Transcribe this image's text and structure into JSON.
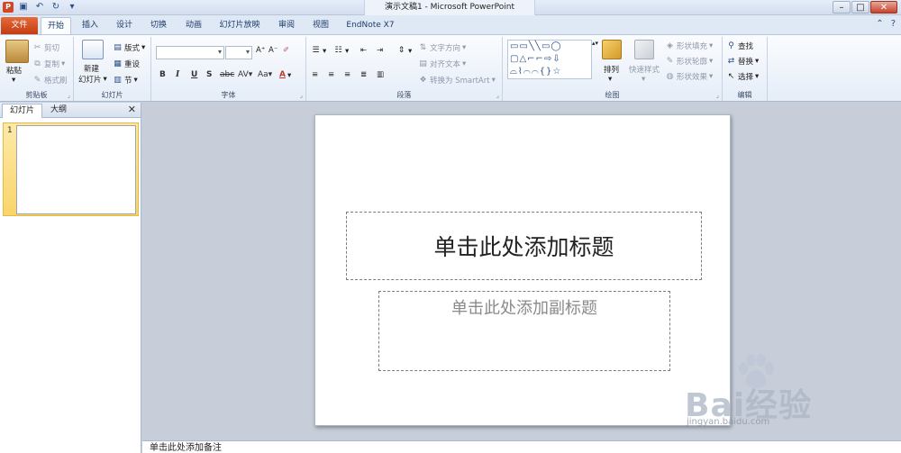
{
  "window": {
    "title": "演示文稿1 - Microsoft PowerPoint",
    "app_icon": "P"
  },
  "tabs": [
    "文件",
    "开始",
    "插入",
    "设计",
    "切换",
    "动画",
    "幻灯片放映",
    "审阅",
    "视图",
    "EndNote X7"
  ],
  "ribbon": {
    "clipboard": {
      "paste": "粘贴",
      "cut": "剪切",
      "copy": "复制",
      "format_painter": "格式刷",
      "name": "剪贴板"
    },
    "slides": {
      "new_slide_line1": "新建",
      "new_slide_line2": "幻灯片",
      "layout": "版式",
      "reset": "重设",
      "section": "节",
      "name": "幻灯片"
    },
    "font": {
      "bold": "B",
      "italic": "I",
      "underline": "U",
      "shadow": "S",
      "strike": "abc",
      "spacing": "AV",
      "case": "Aa",
      "name": "字体"
    },
    "paragraph": {
      "text_direction": "文字方向",
      "align_text": "对齐文本",
      "smartart": "转换为 SmartArt",
      "name": "段落"
    },
    "drawing": {
      "arrange": "排列",
      "quick_styles": "快速样式",
      "shape_fill": "形状填充",
      "shape_outline": "形状轮廓",
      "shape_effects": "形状效果",
      "name": "绘图"
    },
    "editing": {
      "find": "查找",
      "replace": "替换",
      "select": "选择",
      "name": "编辑"
    }
  },
  "panel": {
    "tab_slides": "幻灯片",
    "tab_outline": "大纲",
    "close": "✕",
    "thumb_number": "1"
  },
  "slide": {
    "title_placeholder": "单击此处添加标题",
    "subtitle_placeholder": "单击此处添加副标题"
  },
  "notes": {
    "placeholder": "单击此处添加备注"
  },
  "watermark": {
    "brand": "Bai经验",
    "url": "jingyan.baidu.com"
  },
  "colors": {
    "file_tab": "#d24726",
    "ribbon_bg": "#e5edf8",
    "selected_thumb": "#f9d56a",
    "canvas_bg": "#c7ced9"
  }
}
